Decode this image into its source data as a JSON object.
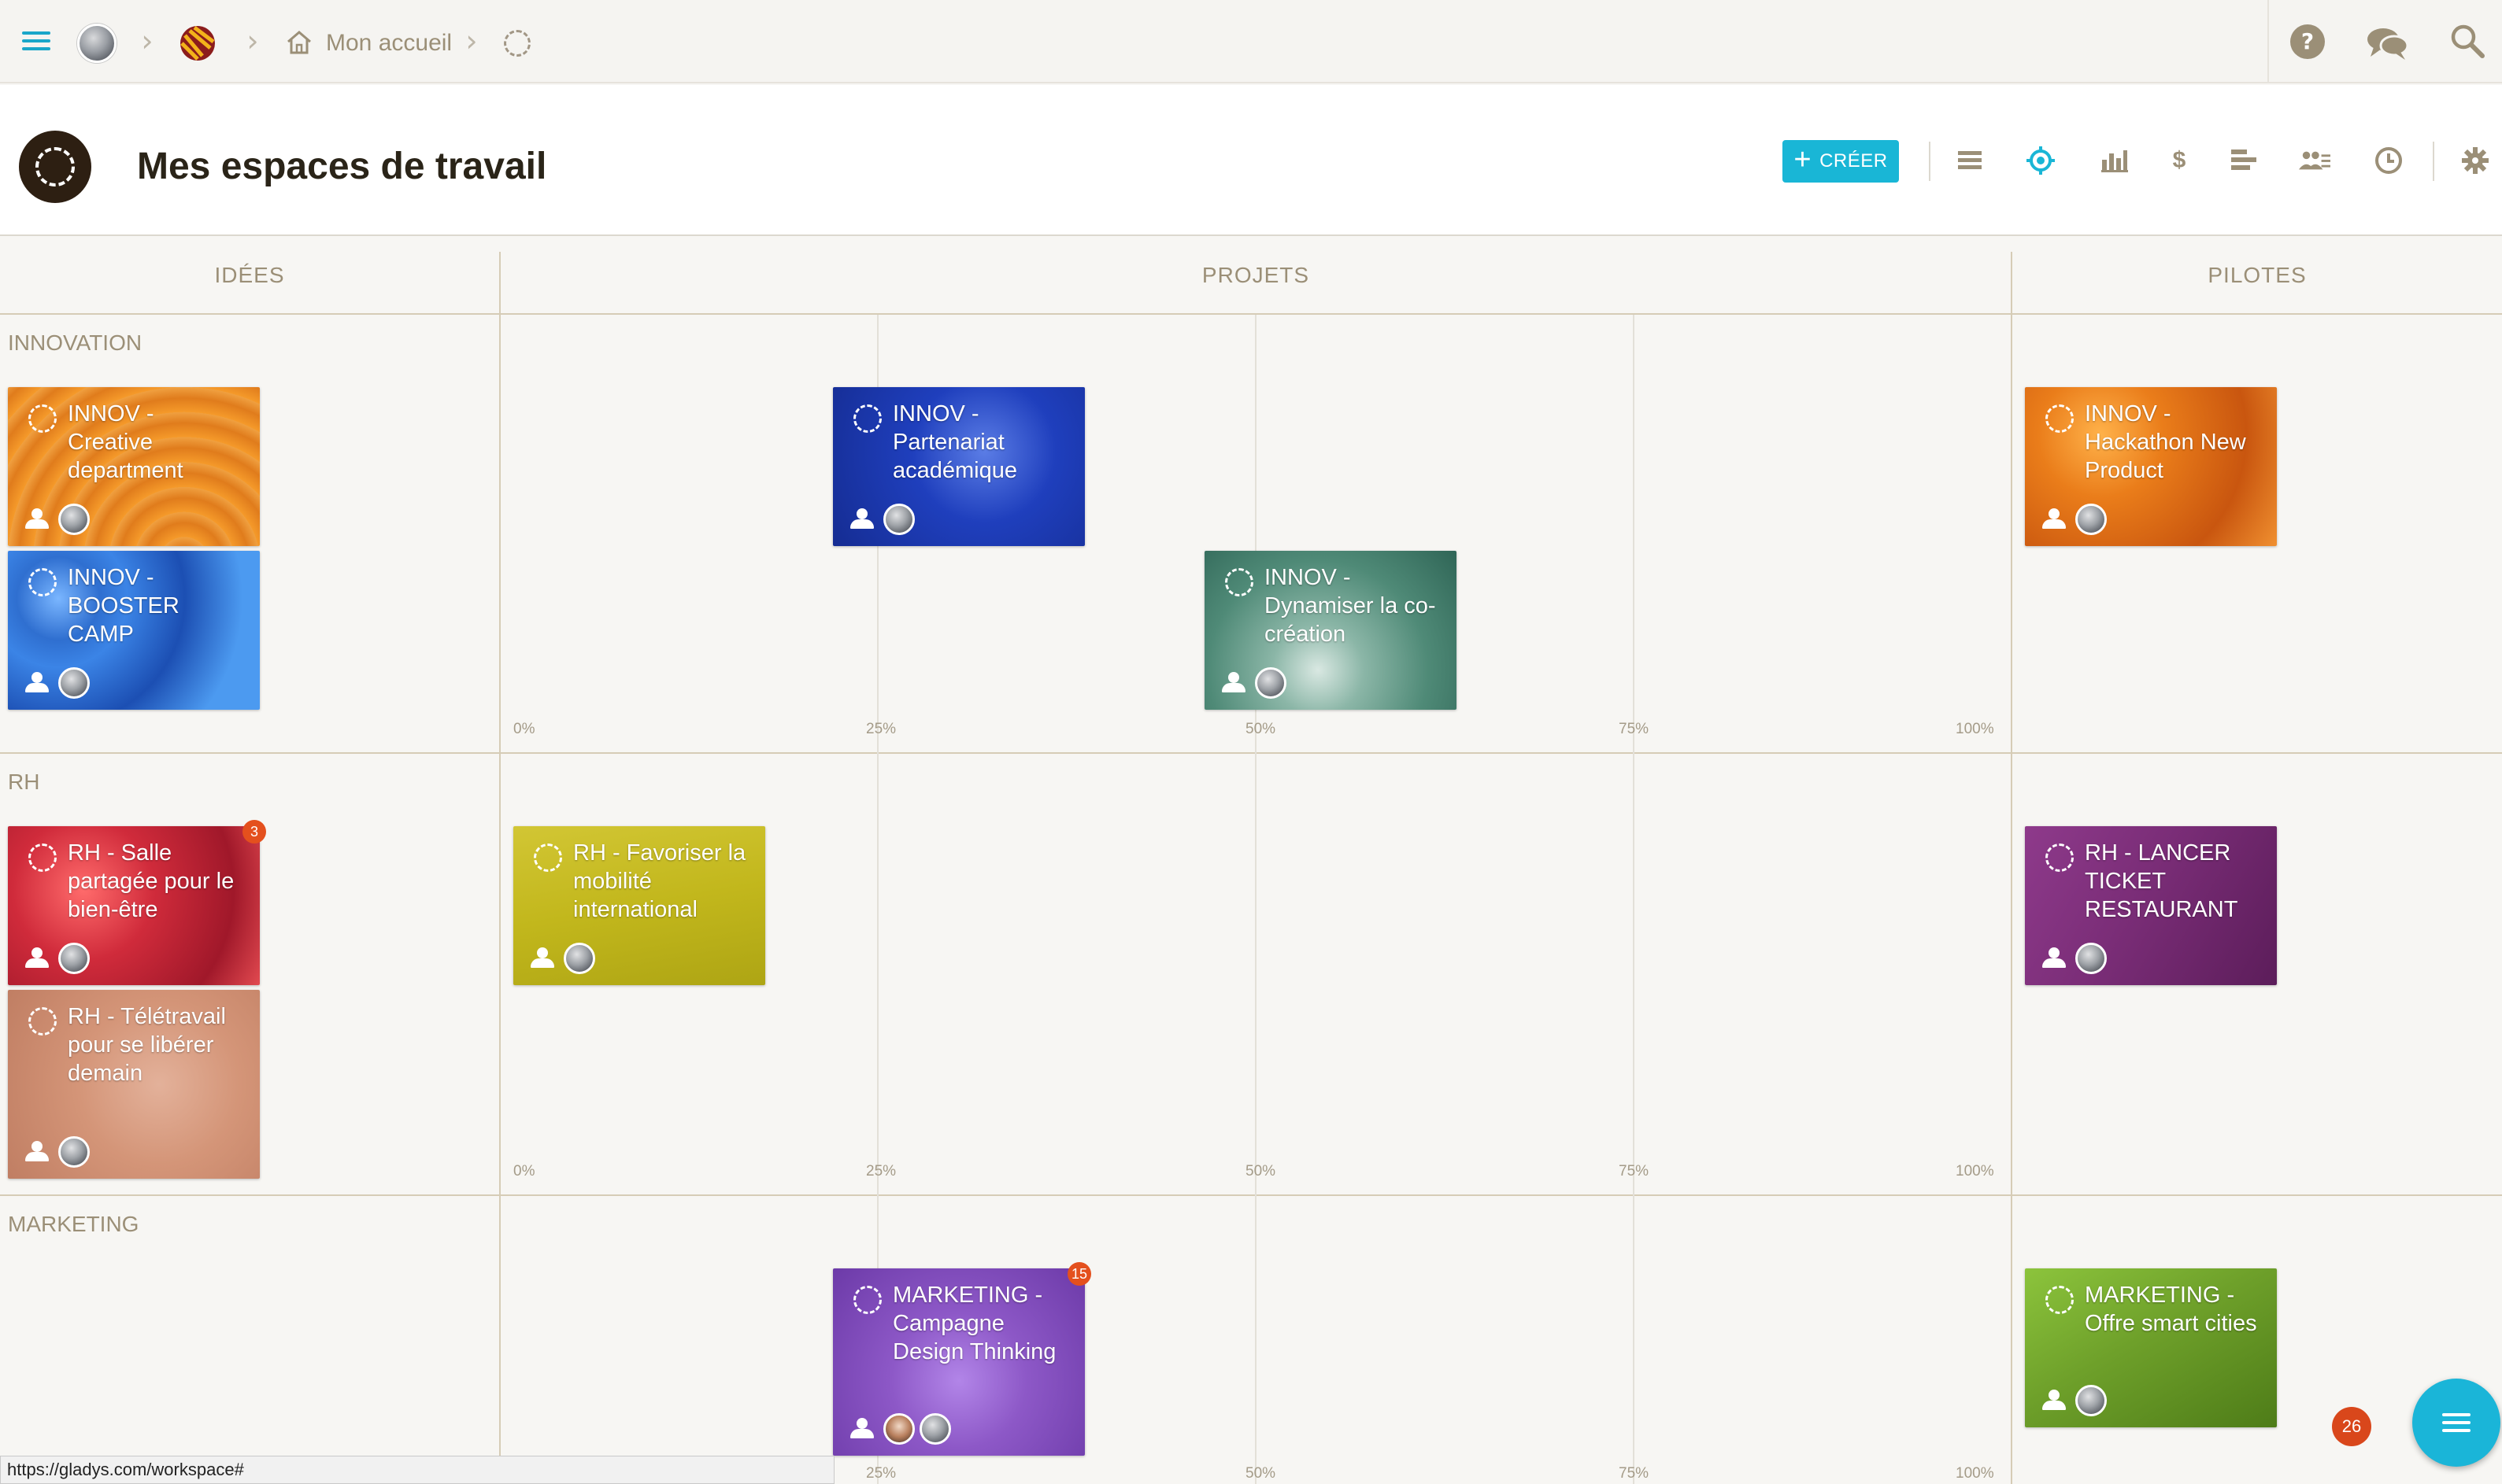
{
  "topbar": {
    "breadcrumb_home": "Mon accueil"
  },
  "header": {
    "title": "Mes espaces de travail",
    "create_label": "CRÉER"
  },
  "columns": [
    "IDÉES",
    "PROJETS",
    "PILOTES"
  ],
  "percent_labels": [
    "0%",
    "25%",
    "50%",
    "75%",
    "100%"
  ],
  "rows": [
    {
      "label": "INNOVATION"
    },
    {
      "label": "RH"
    },
    {
      "label": "MARKETING"
    }
  ],
  "cards": [
    {
      "title": "INNOV - Creative department",
      "row": "INNOVATION",
      "column": "IDÉES",
      "color": "#e07c1c"
    },
    {
      "title": "INNOV - BOOSTER CAMP",
      "row": "INNOVATION",
      "column": "IDÉES",
      "color": "#2f6fd0"
    },
    {
      "title": "INNOV - Partenariat académique",
      "row": "INNOVATION",
      "column": "PROJETS",
      "progress_percent": 25,
      "color": "#1f3fbd"
    },
    {
      "title": "INNOV - Dynamiser la co-création",
      "row": "INNOVATION",
      "column": "PROJETS",
      "progress_percent": 50,
      "color": "#4f8a77"
    },
    {
      "title": "INNOV - Hackathon New Product",
      "row": "INNOVATION",
      "column": "PILOTES",
      "color": "#ea7d1a"
    },
    {
      "title": "RH - Salle partagée pour le bien-être",
      "row": "RH",
      "column": "IDÉES",
      "color": "#d02b3b",
      "badge": "3"
    },
    {
      "title": "RH - Télétravail pour se libérer demain",
      "row": "RH",
      "column": "IDÉES",
      "color": "#d49578"
    },
    {
      "title": "RH - Favoriser la mobilité international",
      "row": "RH",
      "column": "PROJETS",
      "progress_percent": 0,
      "color": "#c2b71c"
    },
    {
      "title": "RH - LANCER TICKET RESTAURANT",
      "row": "RH",
      "column": "PILOTES",
      "color": "#7a2d77"
    },
    {
      "title": "MARKETING - Campagne Design Thinking",
      "row": "MARKETING",
      "column": "PROJETS",
      "progress_percent": 25,
      "color": "#8d58c7",
      "badge": "15"
    },
    {
      "title": "MARKETING - Offre smart cities",
      "row": "MARKETING",
      "column": "PILOTES",
      "color": "#6ea02a"
    }
  ],
  "fab_badge": "26",
  "status_url": "https://gladys.com/workspace#",
  "accent_color": "#19b6d6"
}
